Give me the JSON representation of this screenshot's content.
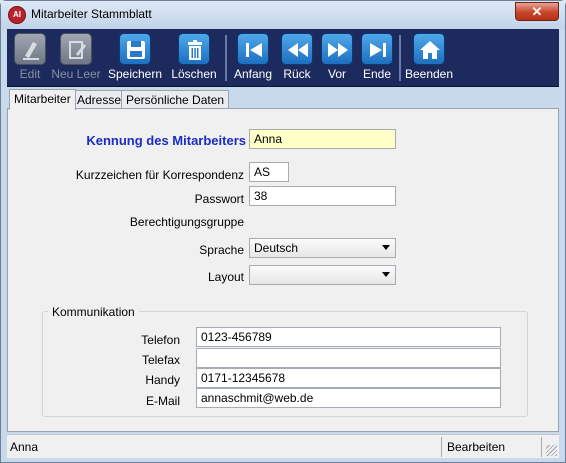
{
  "window": {
    "title": "Mitarbeiter Stammblatt",
    "close_glyph": "✕",
    "app_icon_text": "AI"
  },
  "toolbar": {
    "edit": "Edit",
    "neu_leer": "Neu Leer",
    "speichern": "Speichern",
    "loeschen": "Löschen",
    "anfang": "Anfang",
    "rueck": "Rück",
    "vor": "Vor",
    "ende": "Ende",
    "beenden": "Beenden"
  },
  "tabs": [
    "Mitarbeiter",
    "Adresse",
    "Persönliche Daten"
  ],
  "form": {
    "kennung_label": "Kennung des Mitarbeiters",
    "kennung_value": "Anna",
    "kurzzeichen_label": "Kurzzeichen für Korrespondenz",
    "kurzzeichen_value": "AS",
    "passwort_label": "Passwort",
    "passwort_value": "38",
    "berechtigung_label": "Berechtigungsgruppe",
    "sprache_label": "Sprache",
    "sprache_value": "Deutsch",
    "layout_label": "Layout",
    "layout_value": ""
  },
  "kommunikation": {
    "title": "Kommunikation",
    "telefon_label": "Telefon",
    "telefon_value": "0123-456789",
    "telefax_label": "Telefax",
    "telefax_value": "",
    "handy_label": "Handy",
    "handy_value": "0171-12345678",
    "email_label": "E-Mail",
    "email_value": "annaschmit@web.de"
  },
  "status": {
    "left": "Anna",
    "right": "Bearbeiten"
  },
  "colors": {
    "toolbar": "#1c2a5e",
    "kennung_label": "#1a2cc4",
    "kennung_field": "#ffffc8"
  }
}
